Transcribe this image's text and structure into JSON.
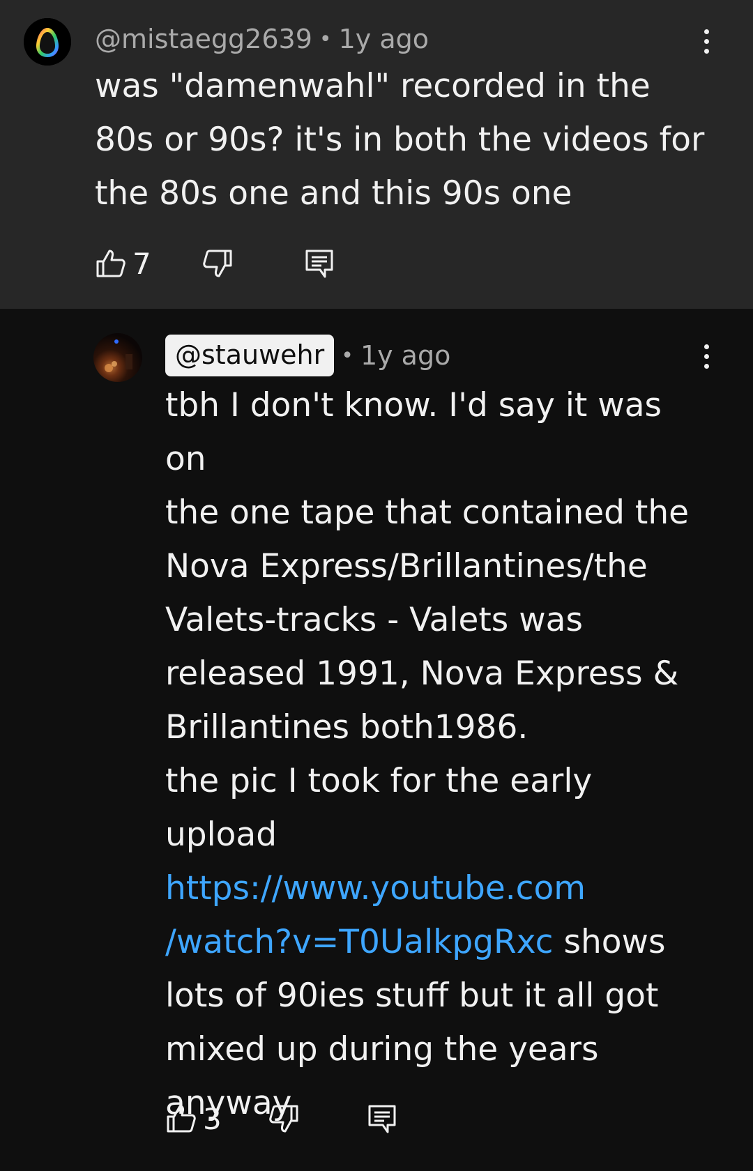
{
  "parent_comment": {
    "handle": "@mistaegg2639",
    "separator": "•",
    "time": "1y ago",
    "text_lines": [
      "was \"damenwahl\" recorded in the",
      "80s or 90s? it's in both the videos for",
      "the 80s one and this 90s one"
    ],
    "likes": "7",
    "icons": {
      "avatar": "egg-avatar-icon",
      "menu": "more-vert-icon",
      "like": "thumbs-up-icon",
      "dislike": "thumbs-down-icon",
      "reply": "reply-comment-icon"
    }
  },
  "reply_comment": {
    "handle": "@stauwehr",
    "separator": "•",
    "time": "1y ago",
    "line_1": "tbh I don't know. I'd say it was on",
    "line_2": "the one tape that contained the",
    "line_3": "Nova Express/Brillantines/the",
    "line_4": "Valets-tracks - Valets was",
    "line_5": "released 1991, Nova Express &",
    "line_6": "Brillantines both1986.",
    "line_7": "the pic I took for the early",
    "line_8": "upload",
    "link_line_1": "https://www.youtube.com",
    "link_line_2": "/watch?v=T0UalkpgRxc",
    "after_link": " shows",
    "line_11": "lots of 90ies stuff but it all got",
    "line_12": "mixed up during the years",
    "line_13": "anyway",
    "likes": "3"
  },
  "colors": {
    "parent_background": "#272727",
    "page_background": "#0f0f0f",
    "text": "#f1f1f1",
    "secondary_text": "#aaaaaa",
    "link": "#3ea6ff",
    "handle_chip_background": "#f1f1f1"
  }
}
